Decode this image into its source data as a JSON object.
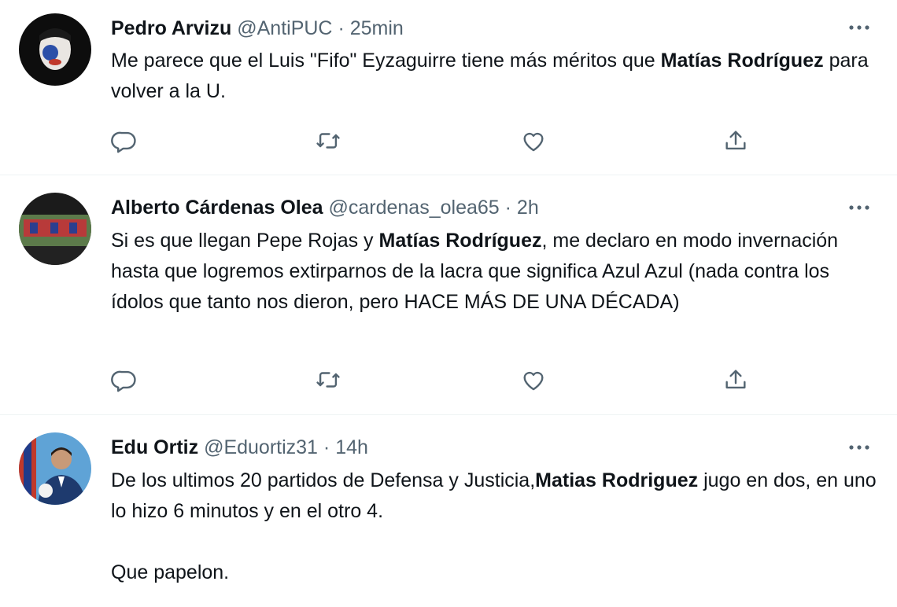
{
  "colors": {
    "text": "#0f1419",
    "secondary": "#536471",
    "divider": "#eff3f4"
  },
  "icons": {
    "more": "more-dots-icon",
    "reply": "reply-icon",
    "retweet": "retweet-icon",
    "like": "heart-icon",
    "share": "share-icon"
  },
  "tweets": [
    {
      "name": "Pedro Arvizu",
      "handle": "@AntiPUC",
      "sep": "·",
      "time": "25min",
      "text": {
        "s1": "Me parece que el Luis \"Fifo\" Eyzaguirre tiene más méritos que ",
        "b1": "Matías Rodríguez",
        "s2": " para volver a la U."
      }
    },
    {
      "name": "Alberto Cárdenas Olea",
      "handle": "@cardenas_olea65",
      "sep": "·",
      "time": "2h",
      "text": {
        "s1": "Si es que llegan Pepe Rojas y ",
        "b1": "Matías Rodríguez",
        "s2": ", me declaro en modo invernación hasta que logremos extirparnos de la lacra que significa Azul Azul (nada contra los ídolos que tanto nos dieron, pero HACE MÁS DE UNA DÉCADA)"
      }
    },
    {
      "name": "Edu Ortiz",
      "handle": "@Eduortiz31",
      "sep": "·",
      "time": "14h",
      "text": {
        "s1": "De los ultimos 20 partidos de Defensa y Justicia,",
        "b1": "Matias Rodriguez",
        "s2": " jugo en dos, en uno lo hizo 6 minutos y en el otro 4.",
        "p2": "Que papelon."
      }
    }
  ]
}
